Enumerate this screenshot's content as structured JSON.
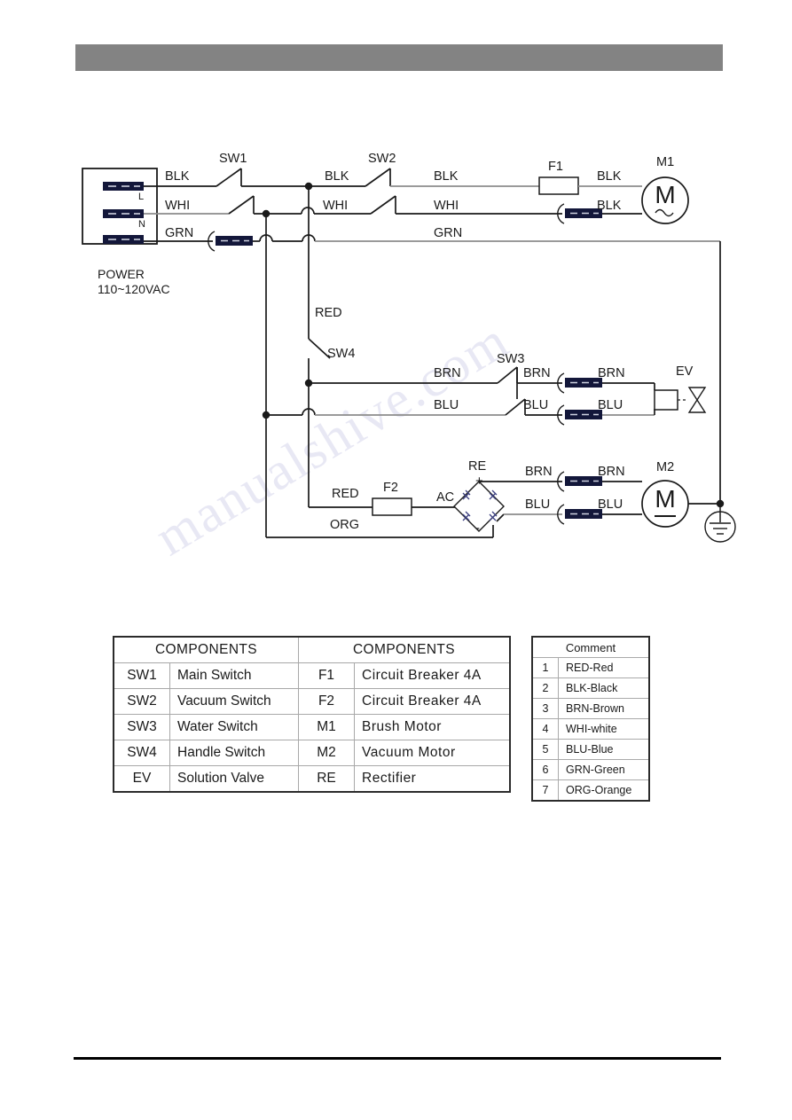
{
  "page": {
    "header_bar_color": "#838383",
    "background": "#ffffff",
    "watermark_text": "manualshive.com"
  },
  "diagram": {
    "power_source": {
      "name": "POWER",
      "voltage": "110~120VAC",
      "terminals": [
        {
          "label": "L",
          "wire": "BLK"
        },
        {
          "label": "N",
          "wire": "WHI"
        },
        {
          "label": "",
          "wire": "GRN"
        }
      ]
    },
    "wire_labels": {
      "blk": "BLK",
      "whi": "WHI",
      "grn": "GRN",
      "red": "RED",
      "org": "ORG",
      "brn": "BRN",
      "blu": "BLU"
    },
    "components": {
      "sw1": "SW1",
      "sw2": "SW2",
      "sw3": "SW3",
      "sw4": "SW4",
      "f1": "F1",
      "f2": "F2",
      "m1": "M1",
      "m2": "M2",
      "ev": "EV",
      "re": "RE",
      "ac": "AC",
      "plus": "+",
      "minus": "-",
      "motor_ac_glyph": "M",
      "motor_dc_glyph": "M"
    },
    "top_branch": {
      "line1_segments": [
        "BLK",
        "BLK",
        "BLK",
        "BLK"
      ],
      "line2_segments": [
        "WHI",
        "WHI",
        "WHI",
        "BLK"
      ],
      "line3_segments": [
        "GRN",
        "GRN"
      ]
    },
    "valve_branch": {
      "upper_segments": [
        "BRN",
        "BRN",
        "BRN"
      ],
      "lower_segments": [
        "BLU",
        "BLU",
        "BLU"
      ]
    },
    "motor_branch": {
      "input_upper": "RED",
      "input_lower": "ORG",
      "output_upper": [
        "BRN",
        "BRN"
      ],
      "output_lower": [
        "BLU",
        "BLU"
      ]
    }
  },
  "components_table": {
    "header_left": "COMPONENTS",
    "header_right": "COMPONENTS",
    "rows": [
      {
        "code_l": "SW1",
        "desc_l": "Main Switch",
        "code_r": "F1",
        "desc_r": "Circuit  Breaker  4A"
      },
      {
        "code_l": "SW2",
        "desc_l": "Vacuum Switch",
        "code_r": "F2",
        "desc_r": "Circuit  Breaker  4A"
      },
      {
        "code_l": "SW3",
        "desc_l": "Water Switch",
        "code_r": "M1",
        "desc_r": "Brush Motor"
      },
      {
        "code_l": "SW4",
        "desc_l": "Handle Switch",
        "code_r": "M2",
        "desc_r": "Vacuum Motor"
      },
      {
        "code_l": "EV",
        "desc_l": "Solution Valve",
        "code_r": "RE",
        "desc_r": "Rectifier"
      }
    ]
  },
  "comment_table": {
    "header": "Comment",
    "rows": [
      {
        "num": "1",
        "text": "RED-Red"
      },
      {
        "num": "2",
        "text": "BLK-Black"
      },
      {
        "num": "3",
        "text": "BRN-Brown"
      },
      {
        "num": "4",
        "text": "WHI-white"
      },
      {
        "num": "5",
        "text": "BLU-Blue"
      },
      {
        "num": "6",
        "text": "GRN-Green"
      },
      {
        "num": "7",
        "text": "ORG-Orange"
      }
    ]
  }
}
